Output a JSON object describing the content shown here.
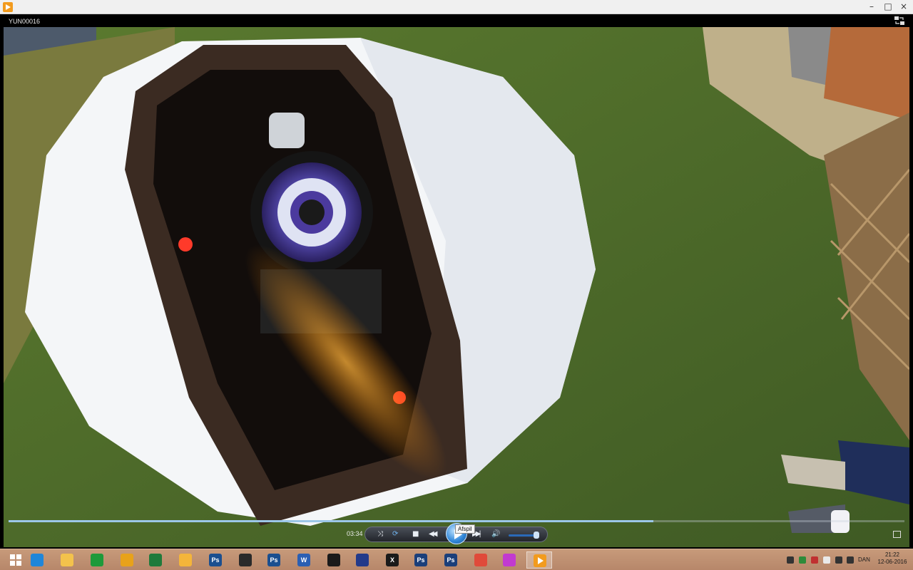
{
  "window": {
    "title": "",
    "minimize_glyph": "–",
    "maximize_glyph": "□",
    "close_glyph": "×"
  },
  "player": {
    "video_title": "YUN00016",
    "elapsed_time": "03:34",
    "progress": 0.72,
    "volume": 0.92,
    "play_tooltip": "Afspil",
    "controls": {
      "shuffle_glyph": "⤨",
      "repeat_glyph": "⟳",
      "stop_glyph": "■",
      "previous_glyph": "◀◀",
      "next_glyph": "▶▶|",
      "volume_glyph": "🔊"
    }
  },
  "taskbar": {
    "items": [
      {
        "name": "start",
        "label": "",
        "icon": "windows-logo-icon",
        "color": "#ffffff"
      },
      {
        "name": "internet-explorer",
        "label": "",
        "icon": "ie-icon",
        "color": "#1f86d9"
      },
      {
        "name": "file-explorer",
        "label": "",
        "icon": "folder-icon",
        "color": "#f3c24c"
      },
      {
        "name": "store",
        "label": "",
        "icon": "store-icon",
        "color": "#1e9a3a"
      },
      {
        "name": "headphones-app",
        "label": "",
        "icon": "headphones-icon",
        "color": "#e8a21a"
      },
      {
        "name": "excel",
        "label": "",
        "icon": "excel-icon",
        "color": "#1f7a3b"
      },
      {
        "name": "mail",
        "label": "",
        "icon": "mail-icon",
        "color": "#f4b53a"
      },
      {
        "name": "photoshop-1",
        "label": "Ps",
        "icon": "photoshop-icon",
        "color": "#1b4f8f"
      },
      {
        "name": "ninja-app",
        "label": "",
        "icon": "ninja-icon",
        "color": "#2a2a2a"
      },
      {
        "name": "photoshop-2",
        "label": "Ps",
        "icon": "photoshop-icon",
        "color": "#1b4f8f"
      },
      {
        "name": "word",
        "label": "W",
        "icon": "word-icon",
        "color": "#2b5fb3"
      },
      {
        "name": "gem-app",
        "label": "",
        "icon": "gem-icon",
        "color": "#1a1a1a"
      },
      {
        "name": "orb-app",
        "label": "",
        "icon": "orb-icon",
        "color": "#233a8a"
      },
      {
        "name": "x-app",
        "label": "X",
        "icon": "x-icon",
        "color": "#1a1a1a"
      },
      {
        "name": "photoshop-3",
        "label": "Ps",
        "icon": "photoshop-icon",
        "color": "#1b3f7a"
      },
      {
        "name": "photoshop-4",
        "label": "Ps",
        "icon": "photoshop-icon",
        "color": "#1b3f7a"
      },
      {
        "name": "chrome",
        "label": "",
        "icon": "chrome-icon",
        "color": "#e04a3a"
      },
      {
        "name": "picasa",
        "label": "",
        "icon": "picasa-icon",
        "color": "#c23ad0"
      },
      {
        "name": "media-player",
        "label": "",
        "icon": "media-player-icon",
        "color": "#f29b1e"
      }
    ],
    "language": "DAN",
    "time": "21:22",
    "date": "12-06-2016"
  }
}
